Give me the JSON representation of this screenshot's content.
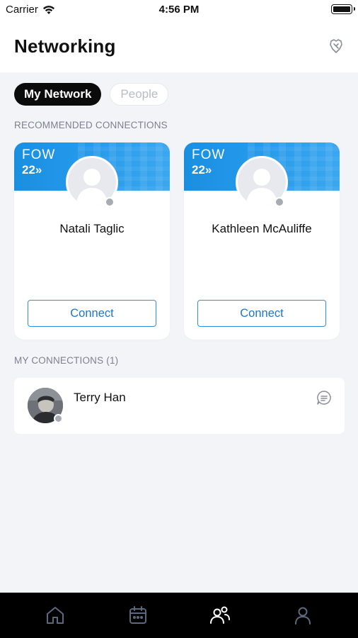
{
  "status_bar": {
    "carrier": "Carrier",
    "time": "4:56 PM"
  },
  "header": {
    "title": "Networking",
    "action_icon": "alert-shield-icon"
  },
  "segments": [
    {
      "label": "My Network",
      "active": true
    },
    {
      "label": "People",
      "active": false
    }
  ],
  "recommended": {
    "label": "RECOMMENDED CONNECTIONS",
    "banner_brand_line1": "FOW",
    "banner_brand_line2": "22»",
    "cards": [
      {
        "name": "Natali Taglic",
        "button": "Connect"
      },
      {
        "name": "Kathleen McAuliffe",
        "button": "Connect"
      }
    ]
  },
  "my_connections": {
    "label": "MY CONNECTIONS (1)",
    "items": [
      {
        "name": "Terry Han",
        "action_icon": "chat-icon"
      }
    ]
  },
  "tabbar": {
    "tabs": [
      {
        "icon": "home-icon",
        "active": false
      },
      {
        "icon": "calendar-icon",
        "active": false
      },
      {
        "icon": "people-icon",
        "active": true
      },
      {
        "icon": "profile-icon",
        "active": false
      }
    ]
  },
  "colors": {
    "accent": "#1a8fe0",
    "background": "#f2f4f8",
    "tab_inactive": "#5c6880",
    "tab_active": "#ffffff"
  }
}
